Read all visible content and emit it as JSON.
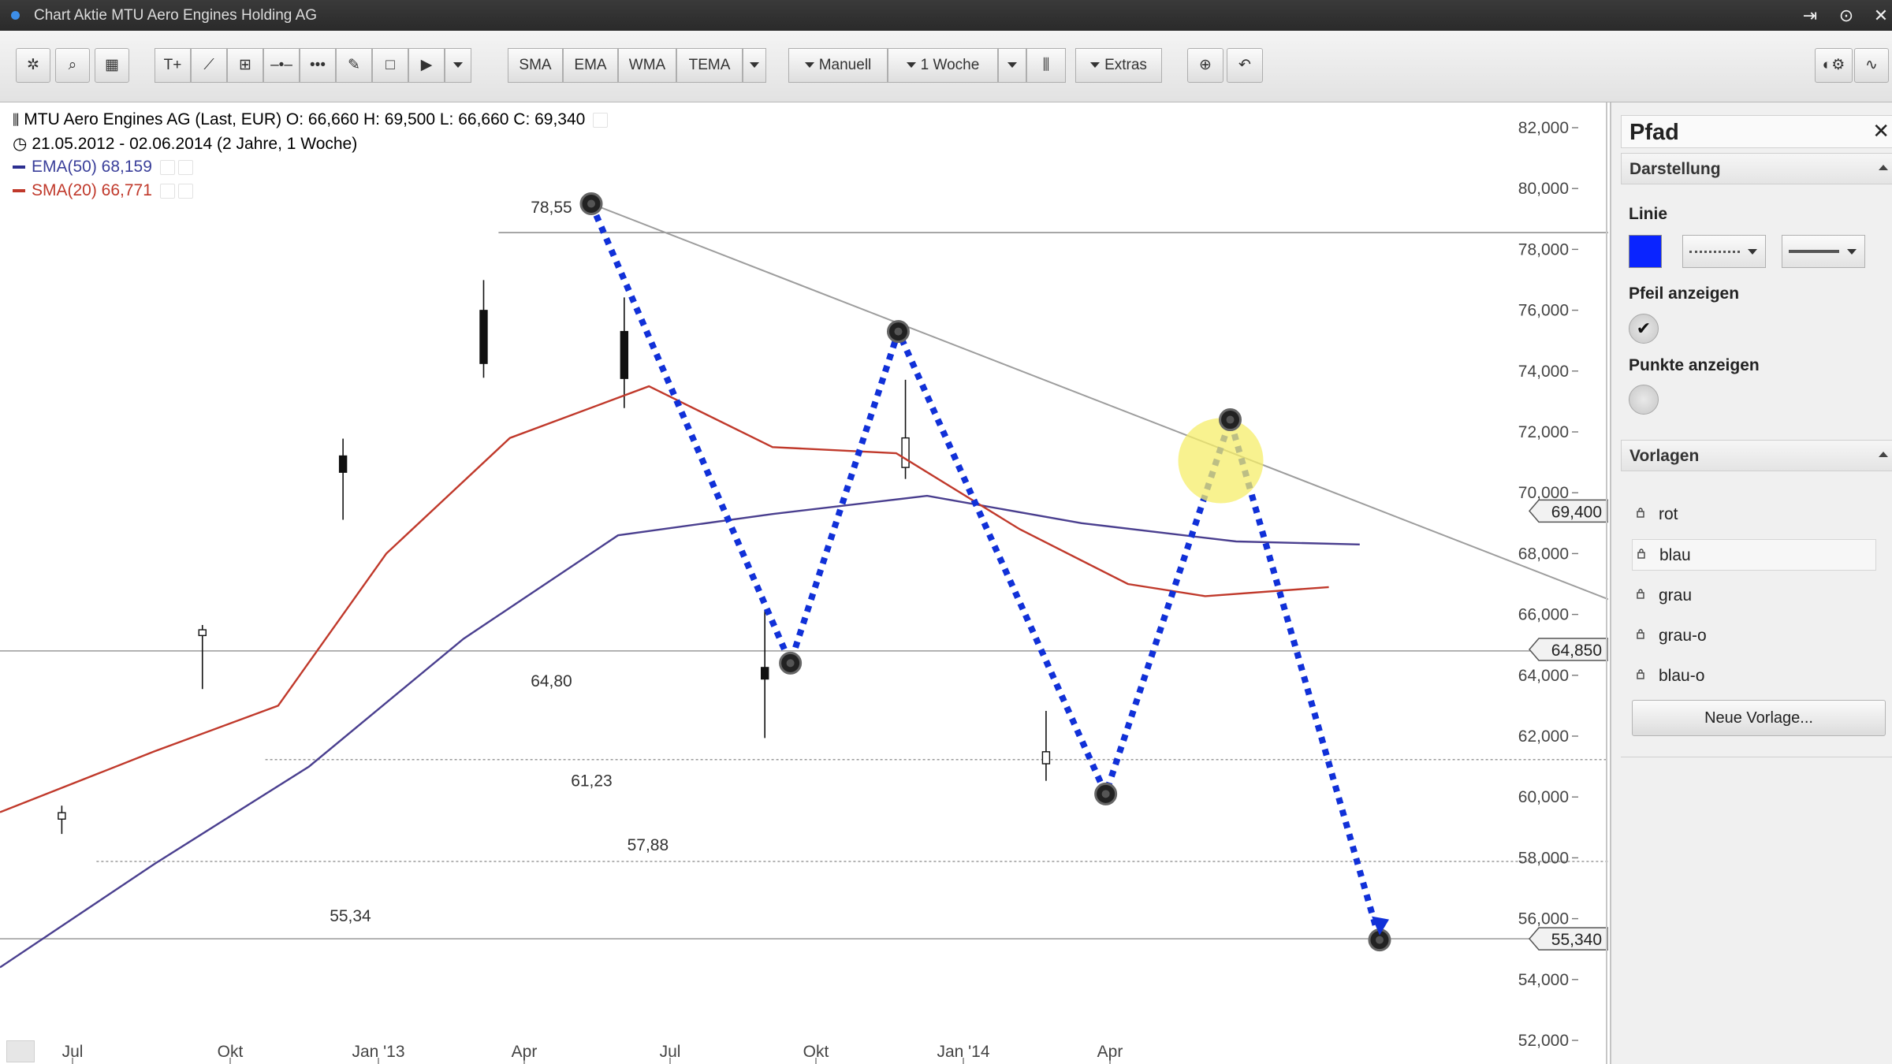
{
  "window": {
    "title": "Chart Aktie MTU Aero Engines Holding AG"
  },
  "toolbar": {
    "indicators": [
      "SMA",
      "EMA",
      "WMA",
      "TEMA"
    ],
    "mode": "Manuell",
    "interval": "1 Woche",
    "extras": "Extras"
  },
  "legend": {
    "line1": "MTU Aero Engines AG (Last, EUR)  O: 66,660  H: 69,500  L: 66,660  C: 69,340",
    "line2": "21.05.2012 - 02.06.2014 (2 Jahre, 1 Woche)",
    "ema": "EMA(50)  68,159",
    "sma": "SMA(20)  66,771"
  },
  "colors": {
    "ema": "#4a3f8f",
    "sma": "#c0392b",
    "path": "#1030d8",
    "price_label_bg": "#f2f2f2",
    "selected_color": "#0a24ff"
  },
  "chart_data": {
    "type": "candlestick",
    "x_ticks": [
      "Jul",
      "Okt",
      "Jan '13",
      "Apr",
      "Jul",
      "Okt",
      "Jan '14",
      "Apr"
    ],
    "y_ticks": [
      "52,000",
      "54,000",
      "56,000",
      "58,000",
      "60,000",
      "62,000",
      "64,000",
      "66,000",
      "68,000",
      "70,000",
      "72,000",
      "74,000",
      "76,000",
      "78,000",
      "80,000",
      "82,000"
    ],
    "ylim": [
      52,
      82
    ],
    "price_markers": [
      "69,400",
      "64,850",
      "55,340"
    ],
    "level_labels": [
      "78,55",
      "64,80",
      "61,23",
      "57,88",
      "55,34"
    ],
    "levels": [
      78.55,
      64.8,
      61.23,
      57.88,
      55.34
    ],
    "path_points": [
      [
        0,
        79.5
      ],
      [
        24,
        64.4
      ],
      [
        37,
        75.3
      ],
      [
        62,
        60.1
      ],
      [
        77,
        72.4
      ],
      [
        95,
        55.3
      ]
    ],
    "trendline": [
      [
        0,
        79.6
      ],
      [
        100,
        66.5
      ]
    ],
    "ema50": [
      [
        0,
        54.4
      ],
      [
        10,
        57.8
      ],
      [
        20,
        61.0
      ],
      [
        30,
        65.2
      ],
      [
        40,
        68.6
      ],
      [
        50,
        69.3
      ],
      [
        60,
        69.9
      ],
      [
        70,
        69.0
      ],
      [
        80,
        68.4
      ],
      [
        88,
        68.3
      ]
    ],
    "sma20": [
      [
        0,
        59.5
      ],
      [
        10,
        61.5
      ],
      [
        18,
        63.0
      ],
      [
        25,
        68.0
      ],
      [
        33,
        71.8
      ],
      [
        42,
        73.5
      ],
      [
        50,
        71.5
      ],
      [
        58,
        71.3
      ],
      [
        66,
        68.8
      ],
      [
        73,
        67.0
      ],
      [
        78,
        66.6
      ],
      [
        86,
        66.9
      ]
    ]
  },
  "panel": {
    "title": "Pfad",
    "section_display": "Darstellung",
    "line_label": "Linie",
    "arrow_label": "Pfeil anzeigen",
    "points_label": "Punkte anzeigen",
    "section_templates": "Vorlagen",
    "templates": [
      "rot",
      "blau",
      "grau",
      "grau-o",
      "blau-o"
    ],
    "new_template": "Neue Vorlage..."
  }
}
